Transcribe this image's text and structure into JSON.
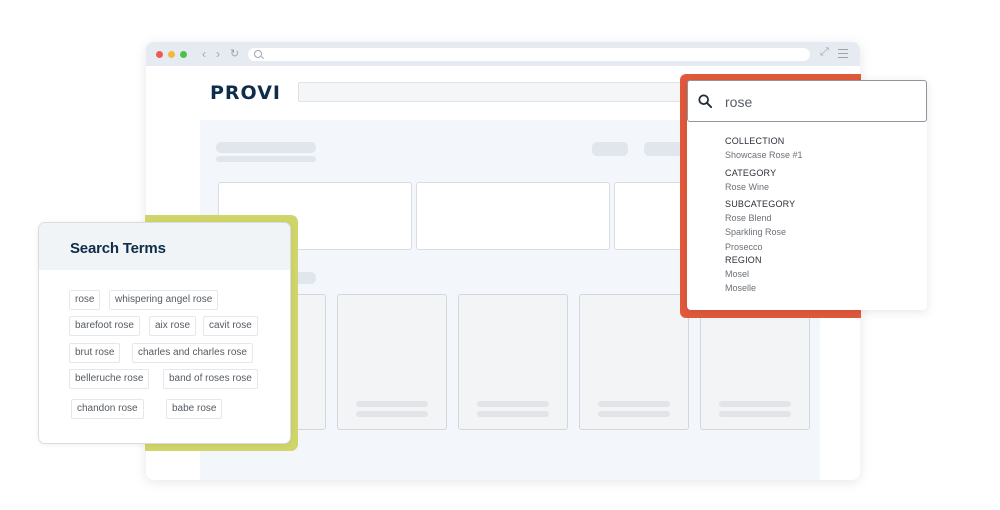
{
  "browser": {
    "nav_back": "‹",
    "nav_forward": "›",
    "nav_reload": "↻",
    "expand_icon": "⤢"
  },
  "brand": {
    "logo": "PROVI"
  },
  "search_terms": {
    "title": "Search Terms",
    "chips": [
      "rose",
      "whispering angel rose",
      "barefoot rose",
      "aix rose",
      "cavit rose",
      "brut rose",
      "charles and charles rose",
      "belleruche rose",
      "band of roses rose",
      "chandon rose",
      "babe rose"
    ]
  },
  "dropdown": {
    "query": "rose",
    "sections": [
      {
        "heading": "COLLECTION",
        "items": [
          "Showcase Rose #1"
        ]
      },
      {
        "heading": "CATEGORY",
        "items": [
          "Rose Wine"
        ]
      },
      {
        "heading": "SUBCATEGORY",
        "items": [
          "Rose Blend",
          "Sparkling Rose",
          "Prosecco"
        ]
      },
      {
        "heading": "REGION",
        "items": [
          "Mosel",
          "Moselle"
        ]
      }
    ]
  },
  "colors": {
    "accent_red": "#e25a3c",
    "accent_green": "#d0d56a",
    "brand_navy": "#0e2d4a"
  }
}
